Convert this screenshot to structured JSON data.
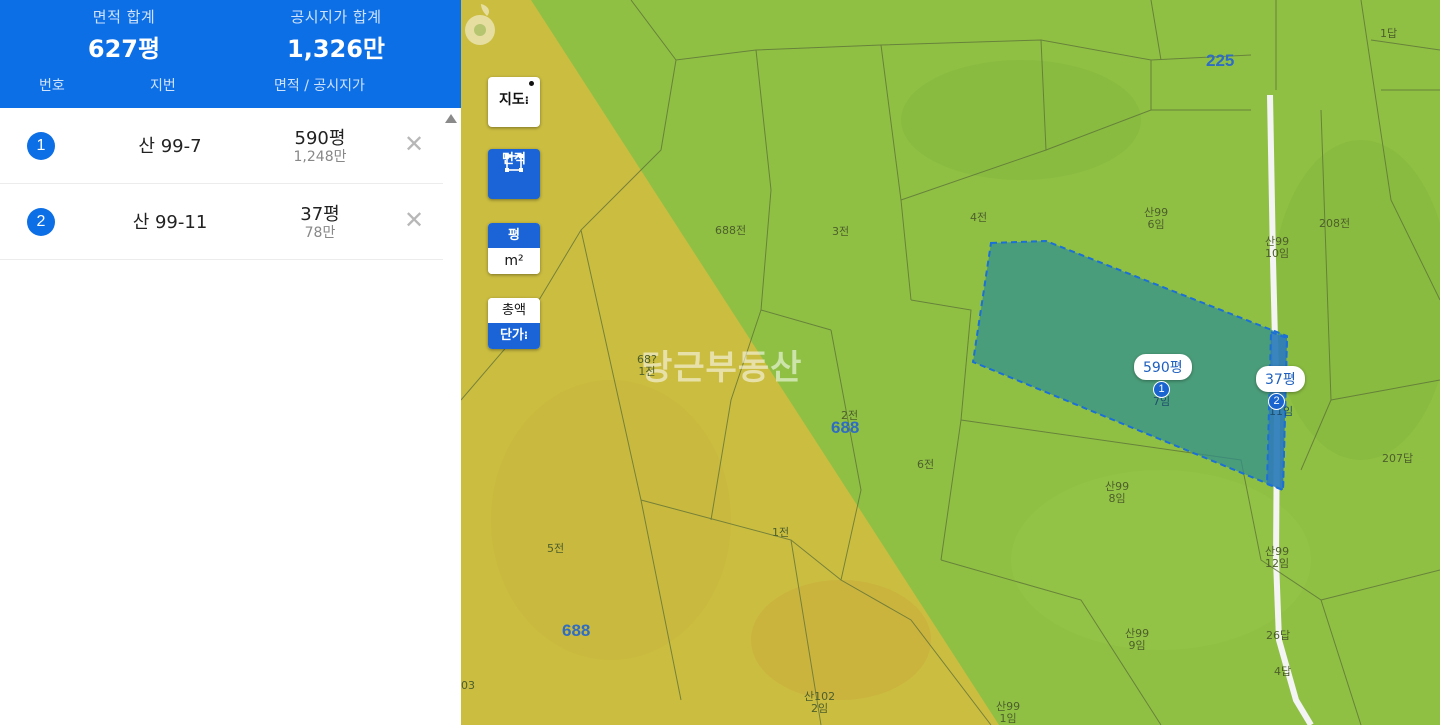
{
  "summary": {
    "area_label": "면적 합계",
    "area_value": "627평",
    "price_label": "공시지가 합계",
    "price_value": "1,326만"
  },
  "columns": {
    "number": "번호",
    "lot": "지번",
    "area_price": "면적 / 공시지가"
  },
  "parcels": [
    {
      "num": "1",
      "lot": "산 99-7",
      "area": "590평",
      "price": "1,248만"
    },
    {
      "num": "2",
      "lot": "산 99-11",
      "area": "37평",
      "price": "78만"
    }
  ],
  "delete_glyph": "✕",
  "map_controls": {
    "map_label": "지도",
    "area_label": "면적",
    "unit_pyeong": "평",
    "unit_m2": "m²",
    "total_label": "총액",
    "unit_price_label": "단가"
  },
  "map": {
    "watermark": "당근부동산",
    "zone_numbers": [
      "225",
      "688",
      "688"
    ],
    "callouts": [
      {
        "text": "590평",
        "marker": "1"
      },
      {
        "text": "37평",
        "marker": "2"
      }
    ],
    "parcel_labels": [
      "1답",
      "688전",
      "3전",
      "4전",
      "산99\n6임",
      "산99\n10임",
      "208전",
      "68?\n1전",
      "2전",
      "6전",
      "207답",
      "산99\n8임",
      "5전",
      "1전",
      "산99\n12임",
      "26답",
      "산99\n9임",
      "4답",
      "03",
      "산102\n2임",
      "산99\n1임",
      "7임",
      "11임"
    ]
  },
  "colors": {
    "brand_blue": "#0d6fe6",
    "zone_green": "#8fc044",
    "zone_yellow": "#cfc03f",
    "selection_fill": "#2f8f8f"
  }
}
